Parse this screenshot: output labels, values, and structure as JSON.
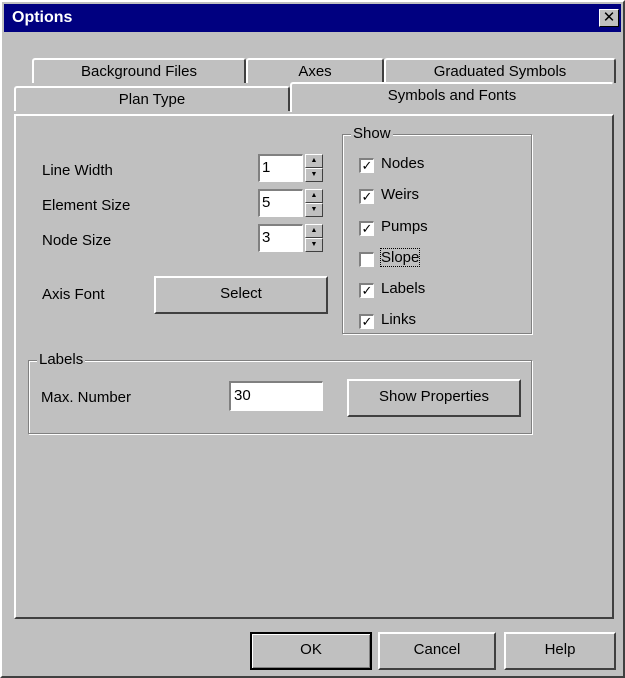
{
  "window": {
    "title": "Options",
    "close_glyph": "✕"
  },
  "tabs": {
    "row_back": [
      "Background Files",
      "Axes",
      "Graduated Symbols"
    ],
    "row_front": [
      "Plan Type",
      "Symbols and Fonts"
    ],
    "active": "Symbols and Fonts"
  },
  "symbols": {
    "line_width_label": "Line Width",
    "line_width_value": "1",
    "element_size_label": "Element Size",
    "element_size_value": "5",
    "node_size_label": "Node Size",
    "node_size_value": "3",
    "axis_font_label": "Axis Font",
    "select_button": "Select"
  },
  "show": {
    "title": "Show",
    "items": [
      {
        "label": "Nodes",
        "checked": true
      },
      {
        "label": "Weirs",
        "checked": true
      },
      {
        "label": "Pumps",
        "checked": true
      },
      {
        "label": "Slope",
        "checked": false
      },
      {
        "label": "Labels",
        "checked": true
      },
      {
        "label": "Links",
        "checked": true
      }
    ]
  },
  "labels_group": {
    "title": "Labels",
    "max_number_label": "Max. Number",
    "max_number_value": "30",
    "show_properties_button": "Show Properties"
  },
  "footer": {
    "ok": "OK",
    "cancel": "Cancel",
    "help": "Help"
  },
  "icons": {
    "spin_up": "▲",
    "spin_down": "▼",
    "check": "✓"
  }
}
